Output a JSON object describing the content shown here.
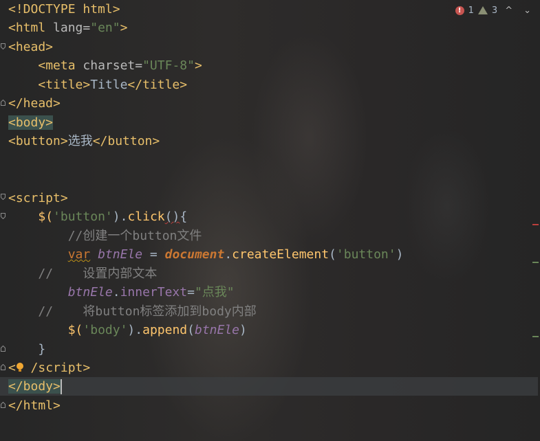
{
  "status": {
    "errors": "1",
    "warnings": "3",
    "prev_glyph": "^",
    "next_glyph": "⌄",
    "error_icon": "error-icon",
    "warning_icon": "warning-triangle-icon"
  },
  "colors": {
    "error_marker": "#bc3f3c",
    "warning_marker": "#6a8759"
  },
  "code": {
    "l1": "<!DOCTYPE html>",
    "l2_a": "<html ",
    "l2_b": "lang",
    "l2_c": "=",
    "l2_d": "\"en\"",
    "l2_e": ">",
    "l3": "<head>",
    "l4_a": "<meta ",
    "l4_b": "charset",
    "l4_c": "=",
    "l4_d": "\"UTF-8\"",
    "l4_e": ">",
    "l5_a": "<title>",
    "l5_b": "Title",
    "l5_c": "</title>",
    "l6": "</head>",
    "l7": "<body>",
    "l8_a": "<button>",
    "l8_b": "选我",
    "l8_c": "</button>",
    "l11": "<script>",
    "l12_a": "$(",
    "l12_b": "'button'",
    "l12_c": ").",
    "l12_d": "click",
    "l12_e": "()",
    "l12_f": "{",
    "l13": "//创建一个button文件",
    "l14_a": "var",
    "l14_b": " ",
    "l14_c": "btnEle",
    "l14_d": " = ",
    "l14_e": "document",
    "l14_f": ".",
    "l14_g": "createElement",
    "l14_h": "(",
    "l14_i": "'button'",
    "l14_j": ")",
    "l15": "//    设置内部文本",
    "l16_a": "btnEle",
    "l16_b": ".",
    "l16_c": "innerText",
    "l16_d": "=",
    "l16_e": "\"点我\"",
    "l17": "//    将button标签添加到body内部",
    "l18_a": "$(",
    "l18_b": "'body'",
    "l18_c": ").",
    "l18_d": "append",
    "l18_e": "(",
    "l18_f": "btnEle",
    "l18_g": ")",
    "l19": "}",
    "l20_a": "<",
    "l20_b": "/script>",
    "l21": "</body>",
    "l22": "</html>"
  }
}
